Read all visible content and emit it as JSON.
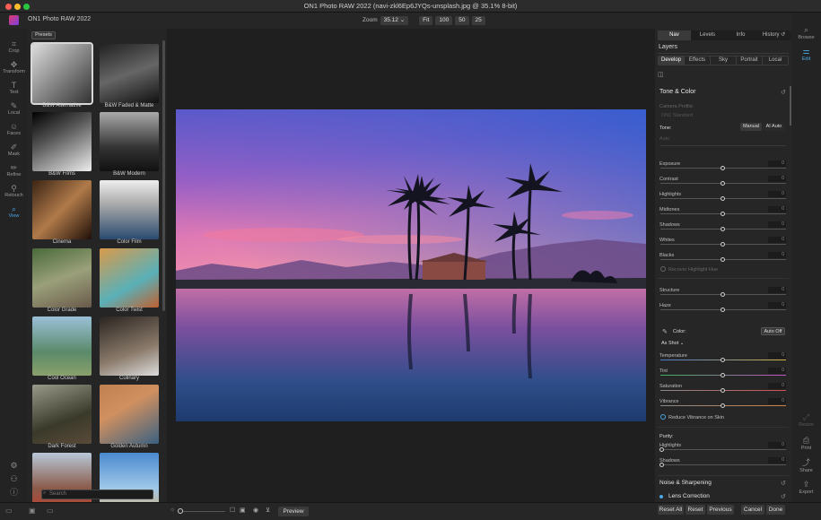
{
  "window": {
    "title": "ON1 Photo RAW 2022 (navi-zkl6Ep6JYQs-unsplash.jpg @ 35.1% 8-bit)"
  },
  "app": {
    "name": "ON1 Photo RAW 2022"
  },
  "zoom": {
    "label": "Zoom",
    "value": "35.12",
    "buttons": [
      "Fit",
      "100",
      "50",
      "25"
    ]
  },
  "left_tools": [
    {
      "label": "Crop",
      "icon": "crop-icon"
    },
    {
      "label": "Transform",
      "icon": "transform-icon"
    },
    {
      "label": "Text",
      "icon": "text-icon"
    },
    {
      "label": "Local",
      "icon": "local-brush-icon"
    },
    {
      "label": "Faces",
      "icon": "faces-icon"
    },
    {
      "label": "Mask",
      "icon": "mask-icon"
    },
    {
      "label": "Refine",
      "icon": "refine-brush-icon"
    },
    {
      "label": "Retouch",
      "icon": "retouch-icon"
    },
    {
      "label": "View",
      "icon": "view-icon",
      "active": true
    }
  ],
  "presets": {
    "tab": "Presets",
    "search_placeholder": "Search",
    "items": [
      {
        "label": "B&W Alternative",
        "selected": true
      },
      {
        "label": "B&W Faded & Matte"
      },
      {
        "label": "B&W Films"
      },
      {
        "label": "B&W Modern"
      },
      {
        "label": "Cinema"
      },
      {
        "label": "Color Film"
      },
      {
        "label": "Color Grade"
      },
      {
        "label": "Color Twist"
      },
      {
        "label": "Cool Ocean"
      },
      {
        "label": "Culinary"
      },
      {
        "label": "Dark Forest"
      },
      {
        "label": "Golden Autumn"
      },
      {
        "label": ""
      },
      {
        "label": ""
      }
    ]
  },
  "bottom": {
    "preview": "Preview"
  },
  "right_tabs": {
    "nav": [
      "Nav",
      "Levels",
      "Info",
      "History"
    ],
    "active": "Nav"
  },
  "layers": {
    "title": "Layers"
  },
  "develop_tabs": {
    "items": [
      "Develop",
      "Effects",
      "Sky",
      "Portrait",
      "Local"
    ],
    "active": "Develop"
  },
  "tone_color": {
    "title": "Tone & Color",
    "camera_profile_label": "Camera Profile:",
    "camera_profile_value": "ON1 Standard",
    "tone_label": "Tone:",
    "tone_buttons": [
      "Manual",
      "AI Auto"
    ],
    "auto_label": "Auto",
    "sliders": [
      {
        "label": "Exposure",
        "value": "0"
      },
      {
        "label": "Contrast",
        "value": "0"
      },
      {
        "label": "Highlights",
        "value": "0"
      },
      {
        "label": "Midtones",
        "value": "0"
      },
      {
        "label": "Shadows",
        "value": "0"
      },
      {
        "label": "Whites",
        "value": "0"
      },
      {
        "label": "Blacks",
        "value": "0"
      }
    ],
    "recover_highlight": "Recover Highlight Hue",
    "structure": {
      "label": "Structure",
      "value": "0"
    },
    "haze": {
      "label": "Haze",
      "value": "0"
    },
    "color_label": "Color:",
    "auto_off": "Auto Off",
    "as_shot": "As Shot",
    "color_sliders": [
      {
        "label": "Temperature",
        "value": "0"
      },
      {
        "label": "Tint",
        "value": "0"
      },
      {
        "label": "Saturation",
        "value": "0"
      },
      {
        "label": "Vibrance",
        "value": "0"
      }
    ],
    "reduce_vibrance": "Reduce Vibrance on Skin",
    "purity_label": "Purity:",
    "purity_sliders": [
      {
        "label": "Highlights",
        "value": "0"
      },
      {
        "label": "Shadows",
        "value": "0"
      }
    ]
  },
  "noise": {
    "title": "Noise & Sharpening"
  },
  "lens": {
    "title": "Lens Correction"
  },
  "footer_buttons": [
    "Reset All",
    "Reset",
    "Previous",
    "Cancel",
    "Done"
  ],
  "right_icons": [
    {
      "label": "Browse",
      "icon": "browse-icon"
    },
    {
      "label": "Edit",
      "icon": "edit-icon",
      "active": true
    },
    {
      "label": "Resize",
      "icon": "resize-icon"
    },
    {
      "label": "Print",
      "icon": "print-icon"
    },
    {
      "label": "Share",
      "icon": "share-icon"
    },
    {
      "label": "Export",
      "icon": "export-icon"
    }
  ]
}
